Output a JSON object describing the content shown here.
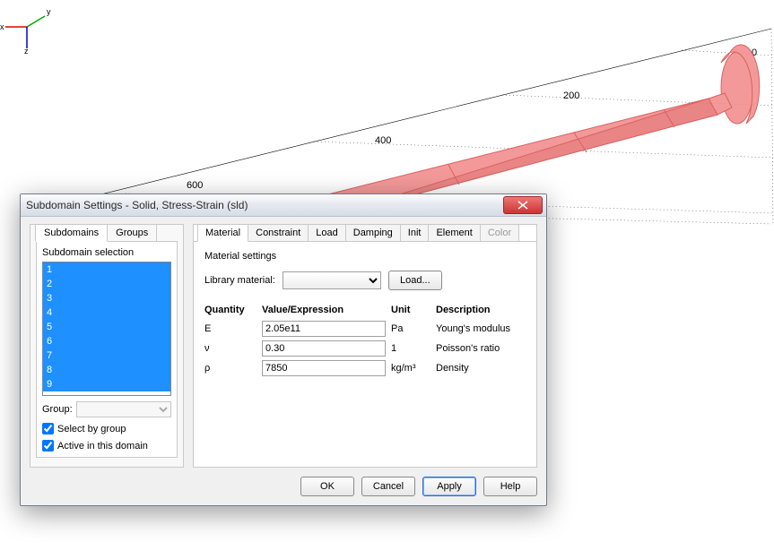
{
  "viewport": {
    "axis_ticks": [
      "0",
      "200",
      "400",
      "600"
    ],
    "triad_labels": {
      "x": "x",
      "y": "y",
      "z": "z"
    }
  },
  "dialog": {
    "title": "Subdomain Settings - Solid, Stress-Strain (sld)",
    "left_tabs": [
      "Subdomains",
      "Groups"
    ],
    "selection_label": "Subdomain selection",
    "subdomains": [
      "1",
      "2",
      "3",
      "4",
      "5",
      "6",
      "7",
      "8",
      "9"
    ],
    "group_label": "Group:",
    "select_by_group": "Select by group",
    "active_in_domain": "Active in this domain",
    "right_tabs": [
      "Material",
      "Constraint",
      "Load",
      "Damping",
      "Init",
      "Element",
      "Color"
    ],
    "material_settings_label": "Material settings",
    "library_material_label": "Library material:",
    "load_button": "Load...",
    "columns": {
      "q": "Quantity",
      "v": "Value/Expression",
      "u": "Unit",
      "d": "Description"
    },
    "rows": [
      {
        "q": "E",
        "v": "2.05e11",
        "u": "Pa",
        "d": "Young's modulus"
      },
      {
        "q": "ν",
        "v": "0.30",
        "u": "1",
        "d": "Poisson's ratio"
      },
      {
        "q": "ρ",
        "v": "7850",
        "u_html": "kg/m³",
        "d": "Density"
      }
    ],
    "buttons": {
      "ok": "OK",
      "cancel": "Cancel",
      "apply": "Apply",
      "help": "Help"
    }
  }
}
